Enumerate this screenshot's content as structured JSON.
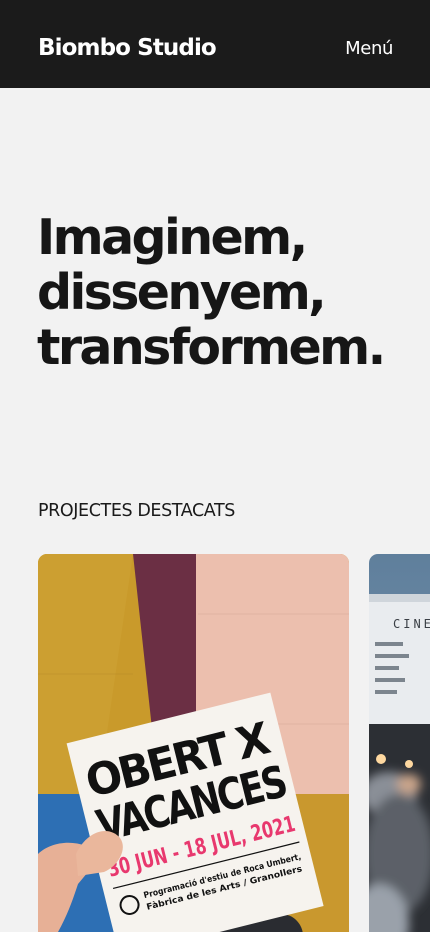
{
  "header": {
    "logo": "Biombo Studio",
    "menu_label": "Menú"
  },
  "hero": {
    "lines": [
      "Imaginem,",
      "dissenyem,",
      "transformem."
    ]
  },
  "featured": {
    "label": "PROJECTES DESTACATS",
    "projects": [
      {
        "poster_title_line1": "OBERT X",
        "poster_title_line2": "VACANCES",
        "poster_dates": "30 JUN - 18 JUL, 2021",
        "poster_subtitle_line1": "Programació d'estiu de Roca Umbert,",
        "poster_subtitle_line2": "Fàbrica de les Arts  /  Granollers"
      },
      {
        "sign_text": "CINEMA"
      }
    ]
  },
  "colors": {
    "header_bg": "#1b1b1b",
    "page_bg": "#f2f2f2",
    "poster_accent": "#e8386e",
    "wall_mustard": "#c99a2b",
    "wall_plum": "#6b2f44",
    "wall_pink": "#ecbfae",
    "wall_blue": "#2d6fb4"
  }
}
